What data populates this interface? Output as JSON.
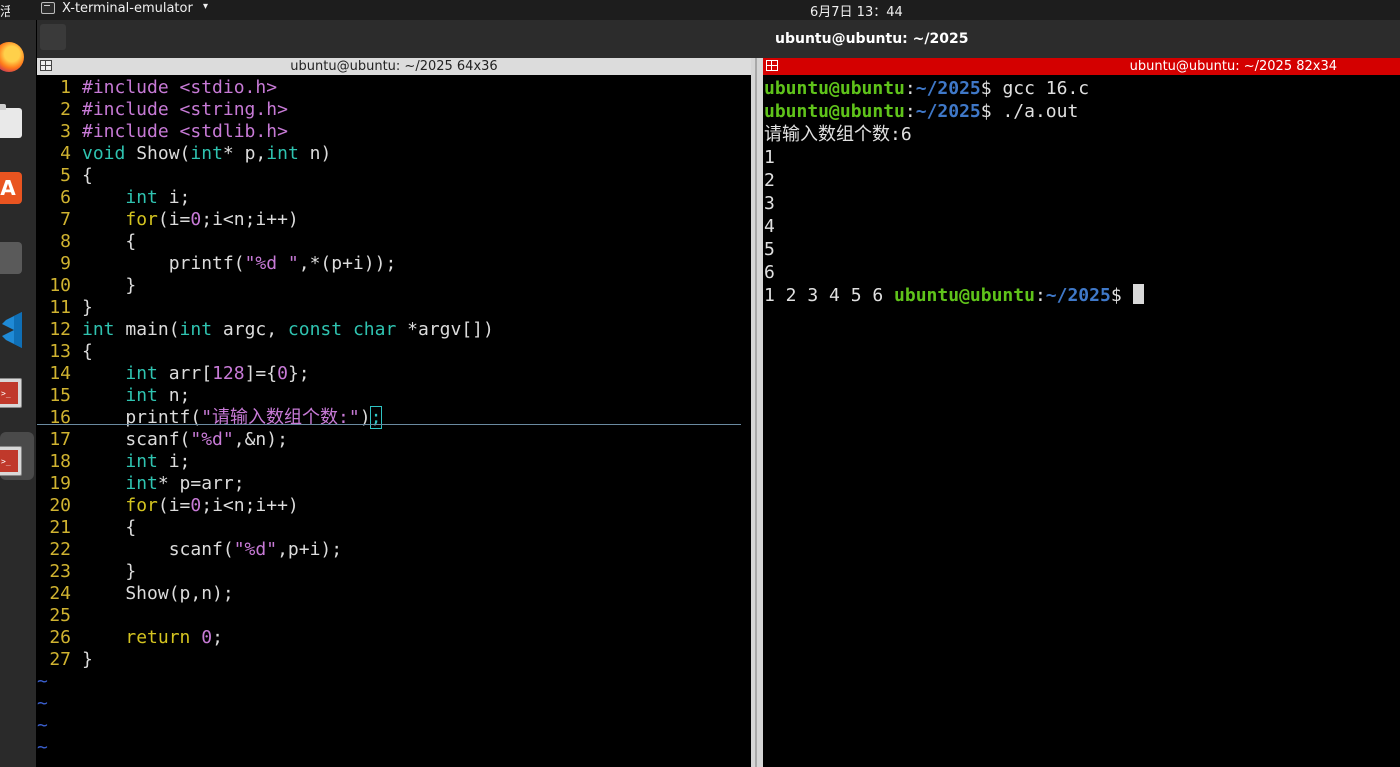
{
  "topbar": {
    "activities_label": "活动",
    "app_name": "X-terminal-emulator",
    "app_menu_arrow": "▾",
    "clock": "6月7日  13：44"
  },
  "dock": {
    "items": [
      "firefox-icon",
      "files-icon",
      "ubuntu-software-icon",
      "app-icon",
      "vscode-icon",
      "terminal-icon",
      "terminal-icon"
    ]
  },
  "window": {
    "title": "ubuntu@ubuntu: ~/2025"
  },
  "left_pane": {
    "title": "ubuntu@ubuntu: ~/2025 64x36",
    "tilde": "~",
    "lines": [
      {
        "n": "1",
        "code": [
          [
            "pre",
            "#include <stdio.h>"
          ]
        ]
      },
      {
        "n": "2",
        "code": [
          [
            "pre",
            "#include <string.h>"
          ]
        ]
      },
      {
        "n": "3",
        "code": [
          [
            "pre",
            "#include <stdlib.h>"
          ]
        ]
      },
      {
        "n": "4",
        "code": [
          [
            "ty",
            "void"
          ],
          [
            "sym",
            " Show("
          ],
          [
            "ty",
            "int"
          ],
          [
            "sym",
            "* p,"
          ],
          [
            "ty",
            "int"
          ],
          [
            "sym",
            " n)"
          ]
        ]
      },
      {
        "n": "5",
        "code": [
          [
            "sym",
            "{"
          ]
        ]
      },
      {
        "n": "6",
        "code": [
          [
            "sym",
            "    "
          ],
          [
            "ty",
            "int"
          ],
          [
            "sym",
            " i;"
          ]
        ]
      },
      {
        "n": "7",
        "code": [
          [
            "sym",
            "    "
          ],
          [
            "kw",
            "for"
          ],
          [
            "sym",
            "(i="
          ],
          [
            "num",
            "0"
          ],
          [
            "sym",
            ";i<n;i++)"
          ]
        ]
      },
      {
        "n": "8",
        "code": [
          [
            "sym",
            "    {"
          ]
        ]
      },
      {
        "n": "9",
        "code": [
          [
            "sym",
            "        printf("
          ],
          [
            "str",
            "\"%d \""
          ],
          [
            "sym",
            ",*(p+i));"
          ]
        ]
      },
      {
        "n": "10",
        "code": [
          [
            "sym",
            "    }"
          ]
        ]
      },
      {
        "n": "11",
        "code": [
          [
            "sym",
            "}"
          ]
        ]
      },
      {
        "n": "12",
        "code": [
          [
            "ty",
            "int"
          ],
          [
            "sym",
            " main("
          ],
          [
            "ty",
            "int"
          ],
          [
            "sym",
            " argc, "
          ],
          [
            "ty",
            "const"
          ],
          [
            "sym",
            " "
          ],
          [
            "ty",
            "char"
          ],
          [
            "sym",
            " *argv[])"
          ]
        ]
      },
      {
        "n": "13",
        "code": [
          [
            "sym",
            "{"
          ]
        ]
      },
      {
        "n": "14",
        "code": [
          [
            "sym",
            "    "
          ],
          [
            "ty",
            "int"
          ],
          [
            "sym",
            " arr["
          ],
          [
            "num",
            "128"
          ],
          [
            "sym",
            "]={"
          ],
          [
            "num",
            "0"
          ],
          [
            "sym",
            "};"
          ]
        ]
      },
      {
        "n": "15",
        "code": [
          [
            "sym",
            "    "
          ],
          [
            "ty",
            "int"
          ],
          [
            "sym",
            " n;"
          ]
        ]
      },
      {
        "n": "16",
        "code": [
          [
            "sym",
            "    printf("
          ],
          [
            "str",
            "\"请输入数组个数:\""
          ],
          [
            "sym",
            ")"
          ],
          [
            "cursor",
            ";"
          ]
        ]
      },
      {
        "n": "17",
        "code": [
          [
            "sym",
            "    scanf("
          ],
          [
            "str",
            "\"%d\""
          ],
          [
            "sym",
            ",&n);"
          ]
        ]
      },
      {
        "n": "18",
        "code": [
          [
            "sym",
            "    "
          ],
          [
            "ty",
            "int"
          ],
          [
            "sym",
            " i;"
          ]
        ]
      },
      {
        "n": "19",
        "code": [
          [
            "sym",
            "    "
          ],
          [
            "ty",
            "int"
          ],
          [
            "sym",
            "* p=arr;"
          ]
        ]
      },
      {
        "n": "20",
        "code": [
          [
            "sym",
            "    "
          ],
          [
            "kw",
            "for"
          ],
          [
            "sym",
            "(i="
          ],
          [
            "num",
            "0"
          ],
          [
            "sym",
            ";i<n;i++)"
          ]
        ]
      },
      {
        "n": "21",
        "code": [
          [
            "sym",
            "    {"
          ]
        ]
      },
      {
        "n": "22",
        "code": [
          [
            "sym",
            "        scanf("
          ],
          [
            "str",
            "\"%d\""
          ],
          [
            "sym",
            ",p+i);"
          ]
        ]
      },
      {
        "n": "23",
        "code": [
          [
            "sym",
            "    }"
          ]
        ]
      },
      {
        "n": "24",
        "code": [
          [
            "sym",
            "    Show(p,n);"
          ]
        ]
      },
      {
        "n": "25",
        "code": []
      },
      {
        "n": "26",
        "code": [
          [
            "sym",
            "    "
          ],
          [
            "kw",
            "return"
          ],
          [
            "sym",
            " "
          ],
          [
            "num",
            "0"
          ],
          [
            "sym",
            ";"
          ]
        ]
      },
      {
        "n": "27",
        "code": [
          [
            "sym",
            "}"
          ]
        ]
      }
    ],
    "tilde_count": 4
  },
  "right_pane": {
    "title": "ubuntu@ubuntu: ~/2025 82x34",
    "lines": [
      [
        [
          "user",
          "ubuntu@ubuntu"
        ],
        [
          "plain",
          ":"
        ],
        [
          "path",
          "~/2025"
        ],
        [
          "plain",
          "$ gcc 16.c"
        ]
      ],
      [
        [
          "user",
          "ubuntu@ubuntu"
        ],
        [
          "plain",
          ":"
        ],
        [
          "path",
          "~/2025"
        ],
        [
          "plain",
          "$ ./a.out"
        ]
      ],
      [
        [
          "plain",
          "请输入数组个数:6"
        ]
      ],
      [
        [
          "plain",
          "1"
        ]
      ],
      [
        [
          "plain",
          "2"
        ]
      ],
      [
        [
          "plain",
          "3"
        ]
      ],
      [
        [
          "plain",
          "4"
        ]
      ],
      [
        [
          "plain",
          "5"
        ]
      ],
      [
        [
          "plain",
          "6"
        ]
      ],
      [
        [
          "plain",
          "1 2 3 4 5 6 "
        ],
        [
          "user",
          "ubuntu@ubuntu"
        ],
        [
          "plain",
          ":"
        ],
        [
          "path",
          "~/2025"
        ],
        [
          "plain",
          "$ "
        ],
        [
          "cursor",
          ""
        ]
      ]
    ]
  },
  "colors": {
    "keyword": "#d4c420",
    "type": "#2fc3b0",
    "string": "#c77ad6",
    "line_number": "#d0b330",
    "prompt_user": "#5fc31a",
    "prompt_path": "#3f78c8",
    "active_titlebar": "#d40000"
  }
}
